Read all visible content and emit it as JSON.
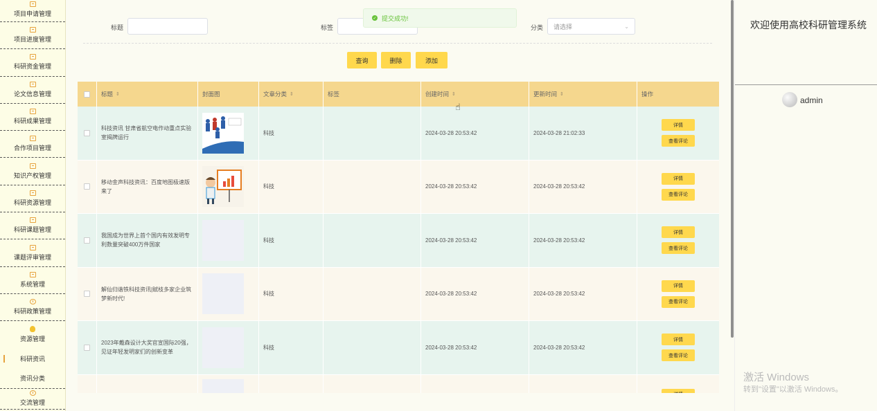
{
  "sidebar": {
    "items": [
      {
        "label": "项目申请管理"
      },
      {
        "label": "项目进度管理"
      },
      {
        "label": "科研资金管理"
      },
      {
        "label": "论文信息管理"
      },
      {
        "label": "科研成果管理"
      },
      {
        "label": "合作项目管理"
      },
      {
        "label": "知识产权管理"
      },
      {
        "label": "科研资源管理"
      },
      {
        "label": "科研课题管理"
      },
      {
        "label": "课题评审管理"
      },
      {
        "label": "系统管理"
      },
      {
        "label": "科研政策管理"
      },
      {
        "label": "资源管理"
      }
    ],
    "sub_items": [
      {
        "label": "科研资讯"
      },
      {
        "label": "资讯分类"
      }
    ],
    "last_item": {
      "label": "交流管理"
    }
  },
  "search": {
    "title_label": "标题",
    "tag_label": "标签",
    "category_label": "分类",
    "category_placeholder": "请选择"
  },
  "toast": {
    "message": "提交成功!"
  },
  "actions": {
    "query": "查询",
    "delete": "删除",
    "add": "添加"
  },
  "table": {
    "headers": {
      "title": "标题",
      "cover": "封面图",
      "category": "文章分类",
      "tags": "标签",
      "created": "创建时间",
      "updated": "更新时间",
      "ops": "操作"
    },
    "rows": [
      {
        "title": "科技资讯 甘肃省航空电作动重点实验室揭牌运行",
        "category": "科技",
        "created": "2024-03-28 20:53:42",
        "updated": "2024-03-28 21:02:33"
      },
      {
        "title": "移动金声科技资讯：百度地图极速版来了",
        "category": "科技",
        "created": "2024-03-28 20:53:42",
        "updated": "2024-03-28 20:53:42"
      },
      {
        "title": "我国成为世界上首个国内有效发明专利数量突破400万件国家",
        "category": "科技",
        "created": "2024-03-28 20:53:42",
        "updated": "2024-03-28 20:53:42"
      },
      {
        "title": "解仙归谐铁科技资讯|赋枝多家企业筑梦新时代!",
        "category": "科技",
        "created": "2024-03-28 20:53:42",
        "updated": "2024-03-28 20:53:42"
      },
      {
        "title": "2023年戴森设计大奖官宣国际20强，见证年轻发明家们的创新变革",
        "category": "科技",
        "created": "2024-03-28 20:53:42",
        "updated": "2024-03-28 20:53:42"
      },
      {
        "title": "",
        "category": "",
        "created": "",
        "updated": ""
      }
    ],
    "detail_label": "详情",
    "comment_label": "查看评论"
  },
  "right_panel": {
    "welcome": "欢迎使用高校科研管理系统",
    "username": "admin",
    "watermark_title": "激活 Windows",
    "watermark_sub": "转到\"设置\"以激活 Windows。"
  },
  "colors": {
    "accent": "#ffd84d",
    "header_bg": "#f5d78e",
    "row_odd": "#e7f4ee",
    "row_even": "#fbf7ed",
    "success": "#67c23a"
  }
}
